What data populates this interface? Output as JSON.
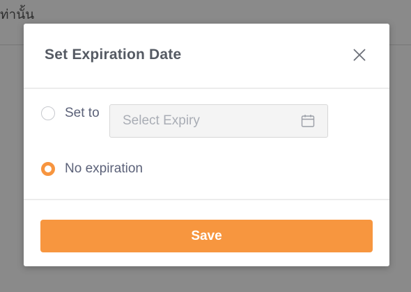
{
  "background": {
    "text": "ท่านั้น"
  },
  "modal": {
    "title": "Set Expiration Date",
    "close_icon": "close-icon",
    "options": [
      {
        "label": "Set to",
        "checked": false
      },
      {
        "label": "No expiration",
        "checked": true
      }
    ],
    "date_field": {
      "value": "",
      "placeholder": "Select Expiry",
      "icon": "calendar-icon"
    },
    "save_label": "Save"
  },
  "colors": {
    "accent": "#f7963f",
    "overlay": "#8a8a8a",
    "label": "#5b6178"
  }
}
